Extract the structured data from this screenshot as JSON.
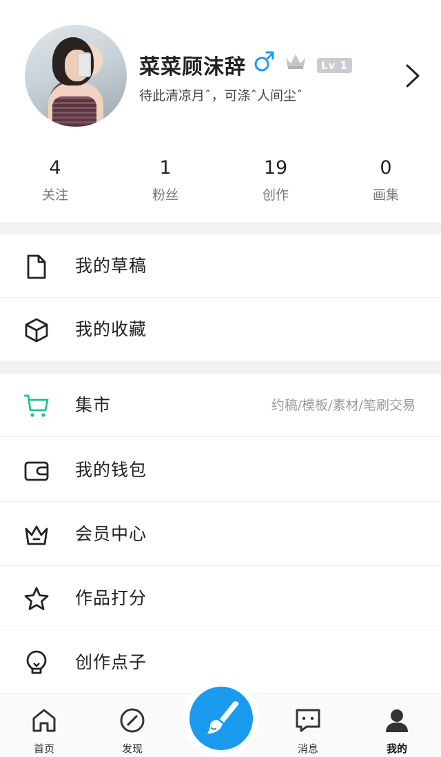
{
  "profile": {
    "name": "菜菜顾沫辞",
    "gender_symbol": "♂",
    "level": "Lv 1",
    "signature": "待此清凉月ˆ，可涤ˆ人间尘ˆ",
    "gender_color": "#1a9bf0"
  },
  "stats": [
    {
      "value": "4",
      "label": "关注"
    },
    {
      "value": "1",
      "label": "粉丝"
    },
    {
      "value": "19",
      "label": "创作"
    },
    {
      "value": "0",
      "label": "画集"
    }
  ],
  "menu_group1": [
    {
      "icon": "file-icon",
      "label": "我的草稿"
    },
    {
      "icon": "cube-icon",
      "label": "我的收藏"
    }
  ],
  "menu_group2": [
    {
      "icon": "cart-icon",
      "label": "集市",
      "hint": "约稿/模板/素材/笔刷交易",
      "icon_color": "#1ec38b"
    },
    {
      "icon": "wallet-icon",
      "label": "我的钱包"
    },
    {
      "icon": "crown-icon",
      "label": "会员中心"
    },
    {
      "icon": "star-icon",
      "label": "作品打分"
    },
    {
      "icon": "lightbulb-icon",
      "label": "创作点子"
    }
  ],
  "bottom_nav": [
    {
      "icon": "home-icon",
      "label": "首页"
    },
    {
      "icon": "compass-icon",
      "label": "发现"
    },
    {
      "icon": "brush-icon",
      "label": ""
    },
    {
      "icon": "message-icon",
      "label": "消息"
    },
    {
      "icon": "user-icon",
      "label": "我的",
      "active": true
    }
  ],
  "colors": {
    "accent": "#1a9bf0",
    "market_green": "#1ec38b",
    "divider": "#f1f3f3"
  }
}
